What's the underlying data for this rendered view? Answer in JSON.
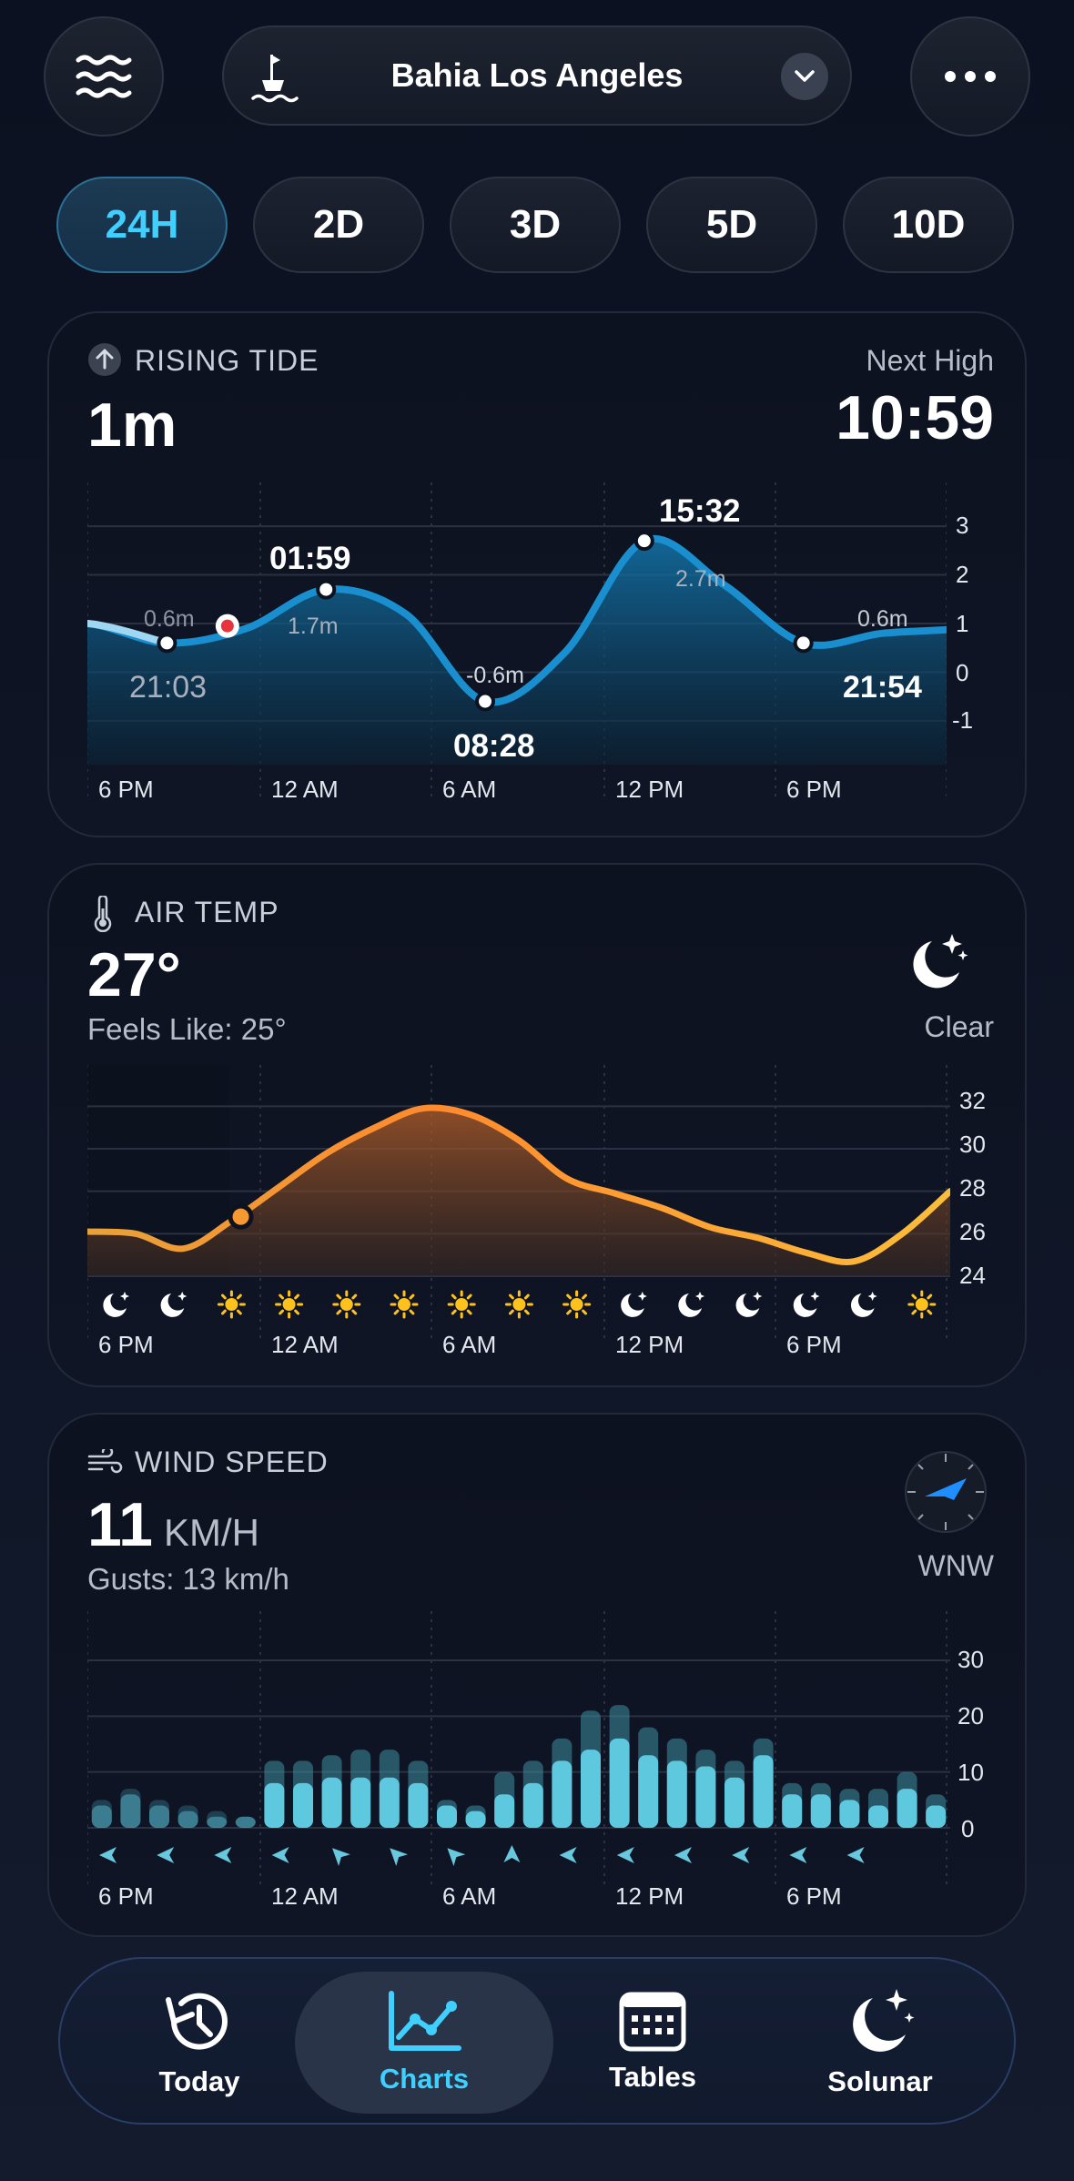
{
  "header": {
    "location": "Bahia Los Angeles"
  },
  "ranges": [
    {
      "label": "24H",
      "active": true
    },
    {
      "label": "2D",
      "active": false
    },
    {
      "label": "3D",
      "active": false
    },
    {
      "label": "5D",
      "active": false
    },
    {
      "label": "10D",
      "active": false
    }
  ],
  "tide": {
    "label": "RISING TIDE",
    "value": "1m",
    "next_label": "Next High",
    "next_time": "10:59",
    "annotations": [
      {
        "time": "21:03",
        "height": "0.6m"
      },
      {
        "time": "01:59",
        "height": "1.7m"
      },
      {
        "time": "08:28",
        "height": "-0.6m"
      },
      {
        "time": "15:32",
        "height": "2.7m"
      },
      {
        "time": "21:54",
        "height": "0.6m"
      }
    ],
    "y_ticks": [
      "3",
      "2",
      "1",
      "0",
      "-1"
    ],
    "x_ticks": [
      "6 PM",
      "12 AM",
      "6 AM",
      "12 PM",
      "6 PM"
    ]
  },
  "air": {
    "label": "AIR TEMP",
    "value": "27°",
    "feels": "Feels Like: 25°",
    "condition": "Clear",
    "y_ticks": [
      "32",
      "30",
      "28",
      "26",
      "24"
    ],
    "x_ticks": [
      "6 PM",
      "12 AM",
      "6 AM",
      "12 PM",
      "6 PM"
    ],
    "hour_icons": [
      "moon",
      "moon",
      "sun",
      "sun",
      "sun",
      "sun",
      "sun",
      "sun",
      "sun",
      "moon",
      "moon",
      "moon",
      "moon",
      "moon",
      "sun"
    ]
  },
  "wind": {
    "label": "WIND SPEED",
    "value": "11",
    "unit": "KM/H",
    "gusts": "Gusts: 13 km/h",
    "direction": "WNW",
    "y_ticks": [
      "30",
      "20",
      "10",
      "0"
    ],
    "x_ticks": [
      "6 PM",
      "12 AM",
      "6 AM",
      "12 PM",
      "6 PM"
    ]
  },
  "nav": [
    {
      "label": "Today",
      "active": false
    },
    {
      "label": "Charts",
      "active": true
    },
    {
      "label": "Tables",
      "active": false
    },
    {
      "label": "Solunar",
      "active": false
    }
  ],
  "chart_data": [
    {
      "type": "area",
      "title": "RISING TIDE",
      "ylim": [
        -1.9,
        3.9
      ],
      "x": [
        -2,
        0,
        2.5,
        5,
        7.5,
        10,
        12.5,
        15,
        17.5,
        20,
        22.5,
        25,
        27.5,
        29
      ],
      "values": [
        0.8,
        1.0,
        0.6,
        0.9,
        1.7,
        1.2,
        -0.6,
        0.4,
        2.7,
        1.8,
        0.6,
        0.8,
        0.9,
        1.1
      ],
      "accent": "#1a8fd0"
    },
    {
      "type": "area",
      "title": "AIR TEMP",
      "ylim": [
        24,
        33
      ],
      "values": [
        26.1,
        26.0,
        25.3,
        26.6,
        28.2,
        29.8,
        31.0,
        31.9,
        31.6,
        30.4,
        28.6,
        27.9,
        27.2,
        26.3,
        25.8,
        25.1,
        24.7,
        26.0,
        28.0
      ],
      "accent": "#f59a32"
    },
    {
      "type": "bar",
      "title": "WIND SPEED",
      "ylim": [
        0,
        30
      ],
      "series": [
        {
          "name": "speed",
          "values": [
            4,
            6,
            4,
            3,
            2,
            2,
            8,
            8,
            9,
            9,
            9,
            8,
            4,
            3,
            6,
            8,
            12,
            14,
            16,
            13,
            12,
            11,
            9,
            13,
            6,
            6,
            5,
            4,
            7,
            4
          ]
        },
        {
          "name": "gusts",
          "values": [
            5,
            7,
            5,
            4,
            3,
            2,
            12,
            12,
            13,
            14,
            14,
            12,
            5,
            4,
            10,
            12,
            16,
            21,
            22,
            18,
            16,
            14,
            12,
            16,
            8,
            8,
            7,
            7,
            10,
            6
          ]
        }
      ],
      "accent": "#5ec8de"
    }
  ]
}
